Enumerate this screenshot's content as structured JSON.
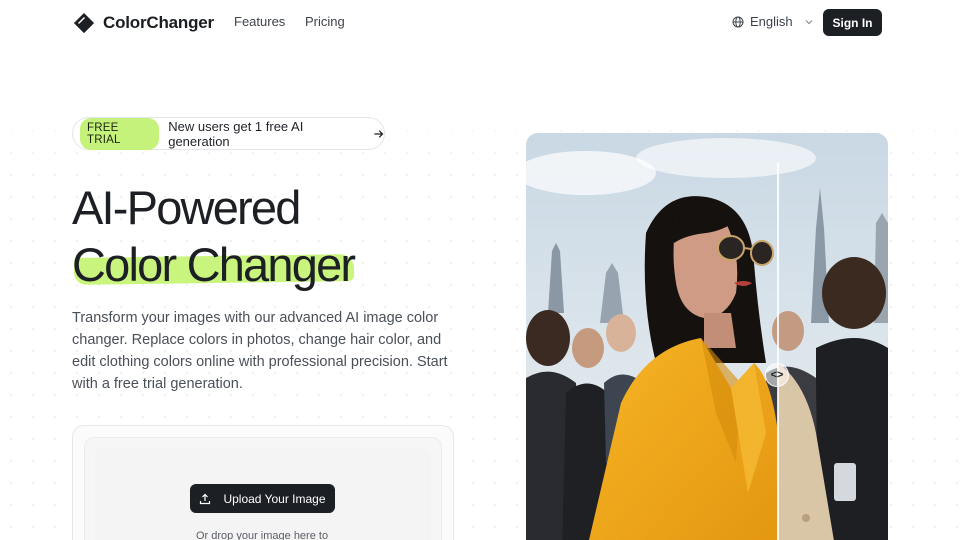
{
  "nav": {
    "brand": "ColorChanger",
    "links": [
      "Features",
      "Pricing"
    ],
    "language": "English",
    "signin_label": "Sign In"
  },
  "trial": {
    "badge": "FREE TRIAL",
    "text": "New users get 1 free AI generation"
  },
  "hero": {
    "title_line1": "AI-Powered",
    "title_line2": "Color Changer",
    "description": "Transform your images with our advanced AI image color changer. Replace colors in photos, change hair color, and edit clothing colors online with professional precision. Start with a free trial generation."
  },
  "upload": {
    "button_label": "Upload Your Image",
    "drop_text": "Or drop your image here to"
  },
  "compare": {
    "handle": "<>"
  },
  "colors": {
    "accent_green": "#c9f57e",
    "dark": "#1c1f23",
    "coat_after": "#f1a91c",
    "coat_before": "#d8c4a5"
  },
  "icons": [
    "logo-icon",
    "globe-icon",
    "chevron-down-icon",
    "arrow-right-icon",
    "upload-icon",
    "compare-handle-icon"
  ]
}
